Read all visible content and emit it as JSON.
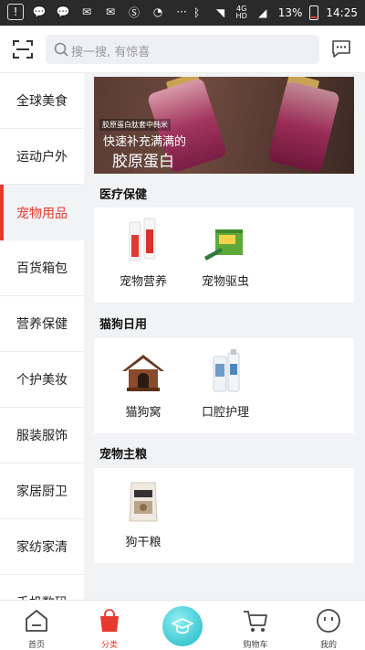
{
  "status_bar": {
    "network": "4G\nHD",
    "battery_percent": "13%",
    "battery_level": 0.13,
    "time": "14:25"
  },
  "header": {
    "search_placeholder": "搜一搜, 有惊喜"
  },
  "sidebar": {
    "items": [
      {
        "label": "全球美食"
      },
      {
        "label": "运动户外"
      },
      {
        "label": "宠物用品"
      },
      {
        "label": "百货箱包"
      },
      {
        "label": "营养保健"
      },
      {
        "label": "个护美妆"
      },
      {
        "label": "服装服饰"
      },
      {
        "label": "家居厨卫"
      },
      {
        "label": "家纺家清"
      },
      {
        "label": "手机数码"
      }
    ],
    "active_index": 2
  },
  "banner": {
    "line1": "胶原蛋白肽套中韩米",
    "line2": "快速补充满满的",
    "line3": "胶原蛋白"
  },
  "sections": [
    {
      "title": "医疗保健",
      "items": [
        {
          "label": "宠物营养",
          "icon": "pet-nutrition-tube-icon"
        },
        {
          "label": "宠物驱虫",
          "icon": "pet-deworming-box-icon"
        }
      ]
    },
    {
      "title": "猫狗日用",
      "items": [
        {
          "label": "猫狗窝",
          "icon": "pet-house-icon"
        },
        {
          "label": "口腔护理",
          "icon": "oral-care-bottle-icon"
        }
      ]
    },
    {
      "title": "宠物主粮",
      "items": [
        {
          "label": "狗干粮",
          "icon": "dog-food-bag-icon"
        }
      ]
    }
  ],
  "bottom_nav": {
    "items": [
      {
        "label": "首页",
        "icon": "home-icon"
      },
      {
        "label": "分类",
        "icon": "shopping-bag-icon"
      },
      {
        "label": "",
        "icon": "graduation-cap-icon"
      },
      {
        "label": "购物车",
        "icon": "cart-icon"
      },
      {
        "label": "我的",
        "icon": "profile-icon"
      }
    ],
    "active_index": 1
  },
  "colors": {
    "accent": "#e8392f",
    "background": "#f2f3f5",
    "status_bar": "#2a2a2a"
  }
}
